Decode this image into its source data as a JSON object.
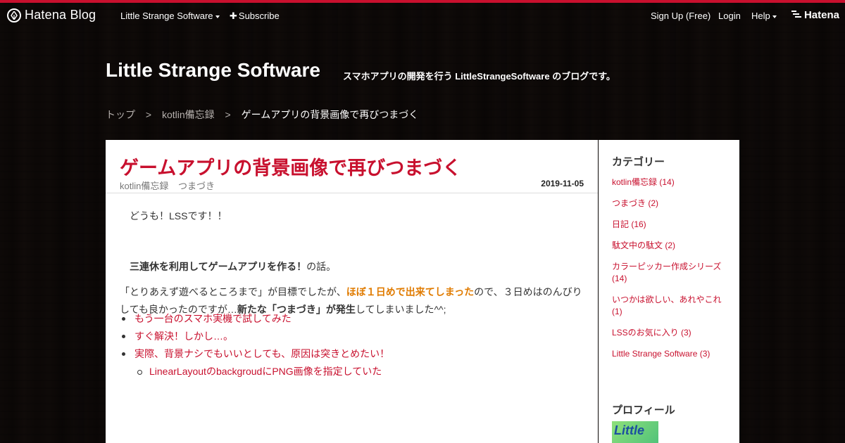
{
  "globalnav": {
    "logo_text": "Hatena Blog",
    "blog_menu": "Little Strange Software",
    "subscribe": "Subscribe",
    "signup": "Sign Up (Free)",
    "login": "Login",
    "help": "Help",
    "hatena": "Hatena",
    "accent_color": "#c8102e"
  },
  "header": {
    "title": "Little Strange Software",
    "description": "スマホアプリの開発を行う LittleStrangeSoftware のブログです。"
  },
  "breadcrumb": {
    "top": "トップ",
    "category": "kotlin備忘録",
    "current": "ゲームアプリの背景画像で再びつまづく",
    "sep": ">"
  },
  "entry": {
    "title": "ゲームアプリの背景画像で再びつまづく",
    "categories": [
      "kotlin備忘録",
      "つまづき"
    ],
    "date": "2019-11-05",
    "p1": "どうも！LSSです！！",
    "p2_bold": "三連休を利用してゲームアプリを作る！",
    "p2_rest": "の話。",
    "p3_a": "「とりあえず遊べるところまで」が目標でしたが、",
    "p3_hl": "ほぼ１日めで出来てしまった",
    "p3_b": "ので、３日めはのんびりしても良かったのですが…",
    "p3_bold": "新たな「つまづき」が発生",
    "p3_c": "してしまいました^^;",
    "toc": [
      "もう一台のスマホ実機で試してみた",
      "すぐ解決！しかし…。",
      "実際、背景ナシでもいいとしても、原因は突きとめたい！"
    ],
    "toc_sub": "LinearLayoutのbackgroudにPNG画像を指定していた"
  },
  "sidebar": {
    "category_heading": "カテゴリー",
    "categories": [
      "kotlin備忘録 (14)",
      "つまづき (2)",
      "日記 (16)",
      "駄文中の駄文 (2)",
      "カラーピッカー作成シリーズ (14)",
      "いつかは欲しい、あれやこれ (1)",
      "LSSのお気に入り (3)",
      "Little Strange Software (3)"
    ],
    "profile_heading": "プロフィール",
    "avatar_text": "Little"
  }
}
